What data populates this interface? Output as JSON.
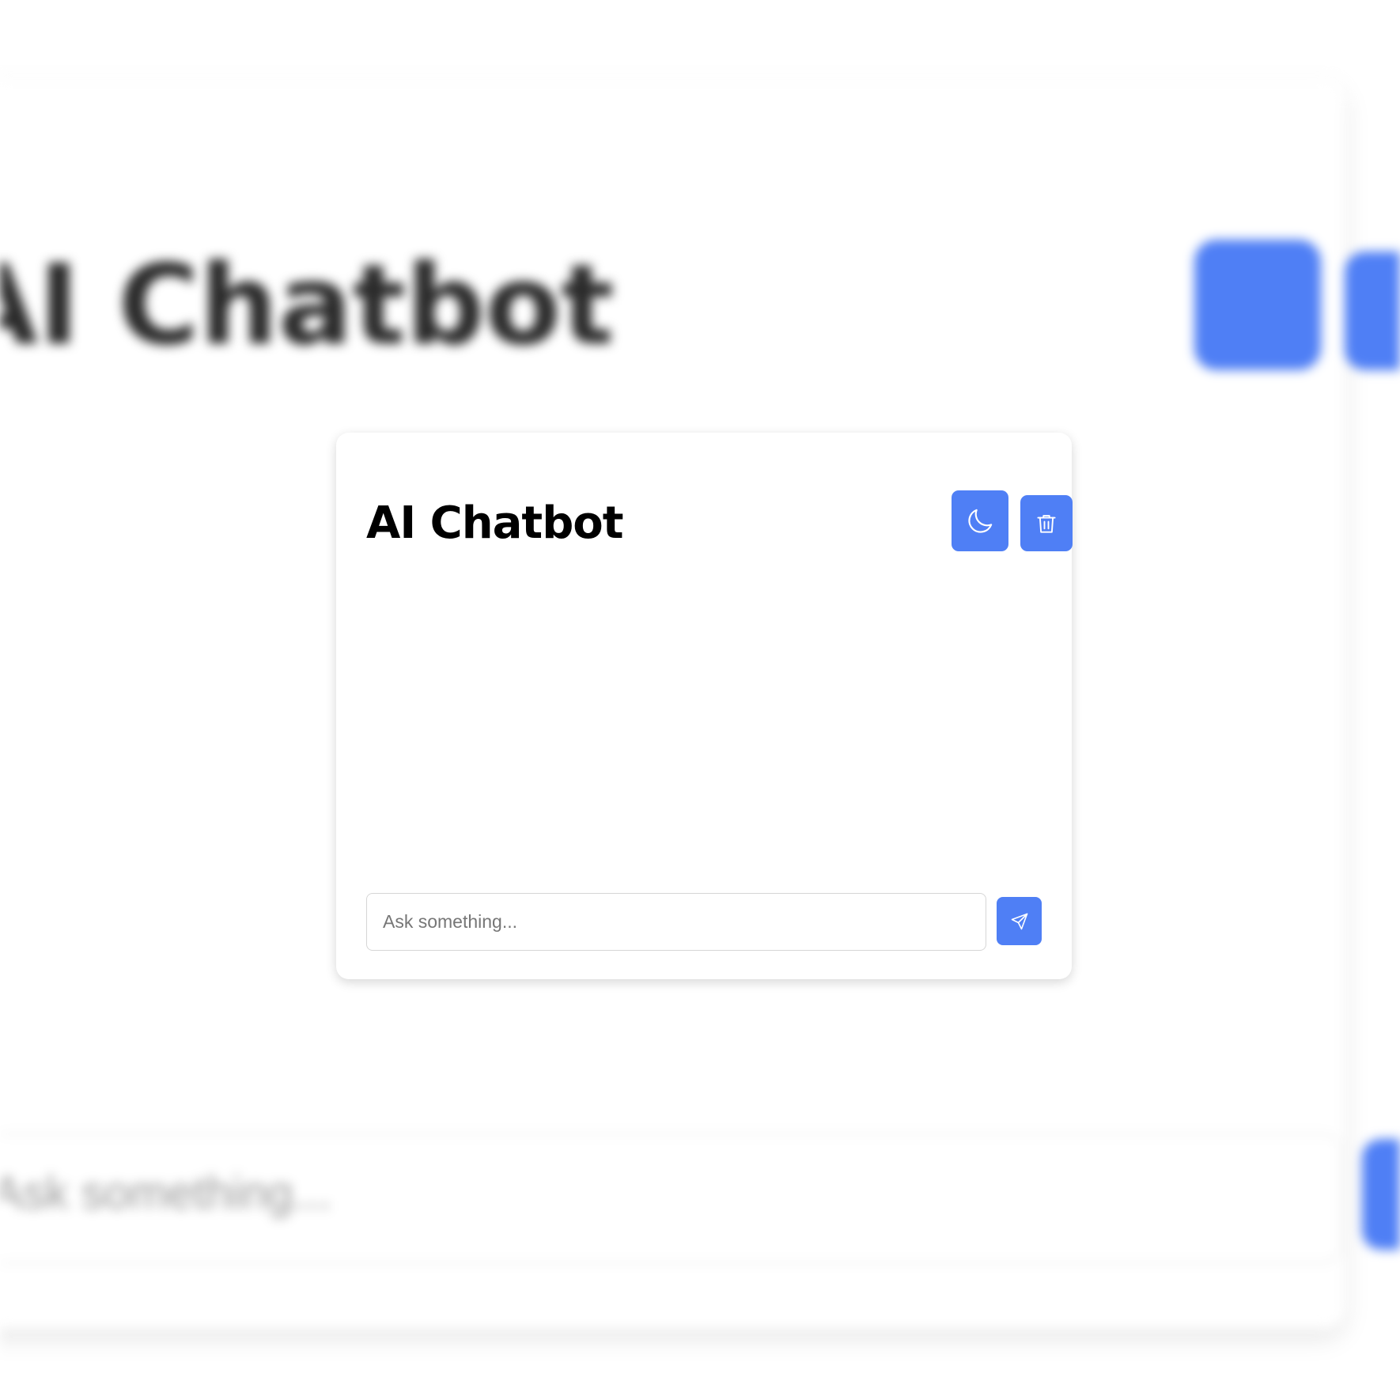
{
  "app": {
    "title": "AI Chatbot",
    "accent_color": "#4f7ff5"
  },
  "header": {
    "title": "AI Chatbot",
    "theme_toggle_icon": "moon-icon",
    "clear_chat_icon": "trash-icon"
  },
  "messages": [],
  "composer": {
    "value": "",
    "placeholder": "Ask something...",
    "send_icon": "send-icon"
  }
}
